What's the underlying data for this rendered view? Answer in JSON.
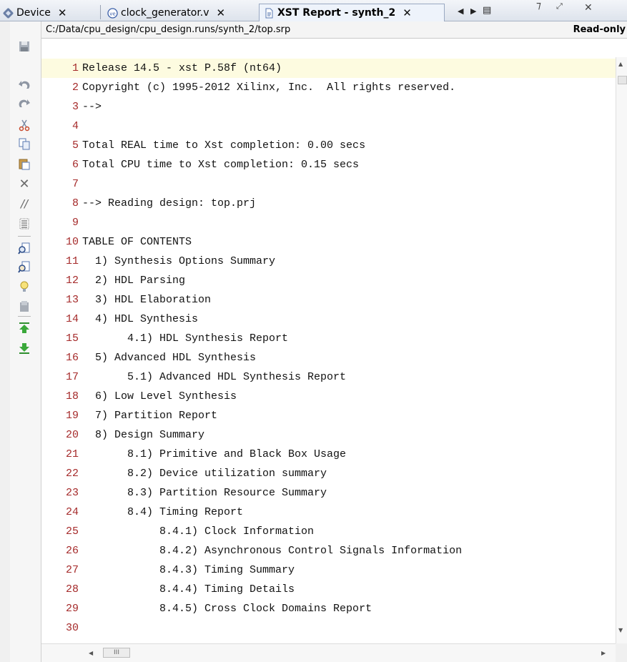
{
  "tabs": [
    {
      "label": "Device",
      "icon": "device-icon",
      "active": false
    },
    {
      "label": "clock_generator.v",
      "icon": "verilog-file-icon",
      "active": false
    },
    {
      "label": "XST Report - synth_2",
      "icon": "report-file-icon",
      "active": true
    }
  ],
  "tab_close_glyph": "✕",
  "nav": {
    "prev": "◀",
    "next": "▶",
    "list": "▤"
  },
  "window_buttons": {
    "restore": "⁊",
    "maximize": "⤢",
    "close": "✕"
  },
  "path": {
    "text": "C:/Data/cpu_design/cpu_design.runs/synth_2/top.srp",
    "status": "Read-only"
  },
  "toolbar_icons": [
    "save-icon",
    "undo-icon",
    "redo-icon",
    "cut-icon",
    "copy-icon",
    "paste-icon",
    "delete-icon",
    "comment-icon",
    "indent-icon",
    "find-icon",
    "replace-icon",
    "hint-icon",
    "bookmark-icon",
    "go-top-icon",
    "go-bottom-icon"
  ],
  "lines": [
    {
      "num": "1",
      "text": "Release 14.5 - xst P.58f (nt64)"
    },
    {
      "num": "2",
      "text": "Copyright (c) 1995-2012 Xilinx, Inc.  All rights reserved."
    },
    {
      "num": "3",
      "text": "-->"
    },
    {
      "num": "4",
      "text": ""
    },
    {
      "num": "5",
      "text": "Total REAL time to Xst completion: 0.00 secs"
    },
    {
      "num": "6",
      "text": "Total CPU time to Xst completion: 0.15 secs"
    },
    {
      "num": "7",
      "text": ""
    },
    {
      "num": "8",
      "text": "--> Reading design: top.prj"
    },
    {
      "num": "9",
      "text": ""
    },
    {
      "num": "10",
      "text": "TABLE OF CONTENTS"
    },
    {
      "num": "11",
      "text": "  1) Synthesis Options Summary"
    },
    {
      "num": "12",
      "text": "  2) HDL Parsing"
    },
    {
      "num": "13",
      "text": "  3) HDL Elaboration"
    },
    {
      "num": "14",
      "text": "  4) HDL Synthesis"
    },
    {
      "num": "15",
      "text": "       4.1) HDL Synthesis Report"
    },
    {
      "num": "16",
      "text": "  5) Advanced HDL Synthesis"
    },
    {
      "num": "17",
      "text": "       5.1) Advanced HDL Synthesis Report"
    },
    {
      "num": "18",
      "text": "  6) Low Level Synthesis"
    },
    {
      "num": "19",
      "text": "  7) Partition Report"
    },
    {
      "num": "20",
      "text": "  8) Design Summary"
    },
    {
      "num": "21",
      "text": "       8.1) Primitive and Black Box Usage"
    },
    {
      "num": "22",
      "text": "       8.2) Device utilization summary"
    },
    {
      "num": "23",
      "text": "       8.3) Partition Resource Summary"
    },
    {
      "num": "24",
      "text": "       8.4) Timing Report"
    },
    {
      "num": "25",
      "text": "            8.4.1) Clock Information"
    },
    {
      "num": "26",
      "text": "            8.4.2) Asynchronous Control Signals Information"
    },
    {
      "num": "27",
      "text": "            8.4.3) Timing Summary"
    },
    {
      "num": "28",
      "text": "            8.4.4) Timing Details"
    },
    {
      "num": "29",
      "text": "            8.4.5) Cross Clock Domains Report"
    },
    {
      "num": "30",
      "text": ""
    }
  ],
  "scroll": {
    "left": "◀",
    "right": "▶",
    "up": "▲",
    "down": "▼",
    "grip": "III"
  },
  "colors": {
    "line_number": "#a52a2a",
    "current_line": "#fdfbe0"
  }
}
